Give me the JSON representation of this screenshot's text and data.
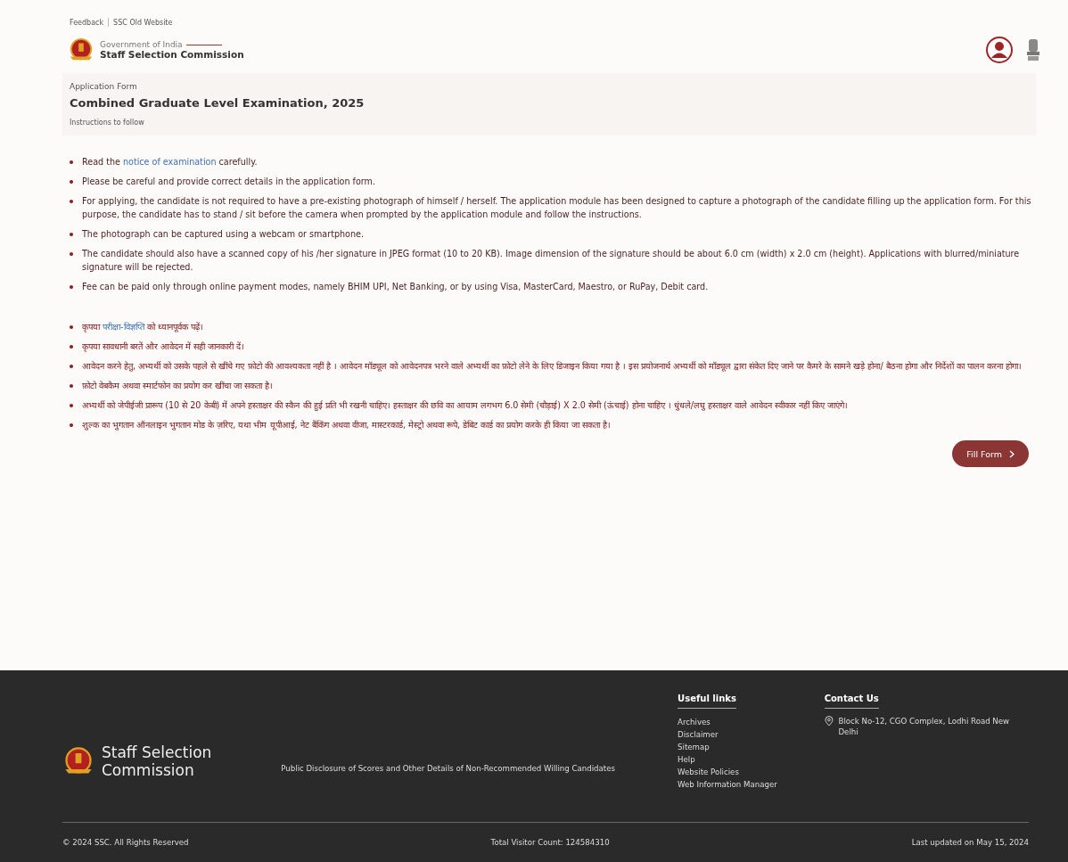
{
  "top_links": [
    "Feedback",
    "SSC Old Website"
  ],
  "header": {
    "subtitle": "Government of India",
    "title": "Staff Selection Commission"
  },
  "form_header": {
    "label": "Application Form",
    "title": "Combined Graduate Level Examination, 2025",
    "note": "Instructions to follow"
  },
  "instructions_en": [
    {
      "parts": [
        {
          "kind": "text",
          "text": "Read the "
        },
        {
          "kind": "link",
          "text": "notice of examination"
        },
        {
          "kind": "text",
          "text": " carefully."
        }
      ]
    },
    {
      "parts": [
        {
          "kind": "text",
          "text": "Please be careful and provide correct details in the application form."
        }
      ]
    },
    {
      "parts": [
        {
          "kind": "text",
          "text": "For applying, the candidate is not required to have a pre-existing photograph of himself / herself. The application module has been designed to capture a photograph of the candidate filling up the application form. For this purpose, the candidate has to stand / sit before the camera when prompted by the application module and follow the instructions."
        }
      ]
    },
    {
      "parts": [
        {
          "kind": "text",
          "text": "The photograph can be captured using a webcam or smartphone."
        }
      ]
    },
    {
      "parts": [
        {
          "kind": "text",
          "text": "The candidate should also have a scanned copy of his /her signature in JPEG format (10 to 20 KB). Image dimension of the signature should be about 6.0 cm (width) x 2.0 cm (height). Applications with blurred/miniature signature will be rejected."
        }
      ]
    },
    {
      "parts": [
        {
          "kind": "text",
          "text": "Fee can be paid only through online payment modes, namely BHIM UPI, Net Banking, or by using Visa, MasterCard, Maestro, or RuPay, Debit card."
        }
      ]
    }
  ],
  "instructions_hi": [
    {
      "parts": [
        {
          "kind": "text",
          "text": "कृपया "
        },
        {
          "kind": "link",
          "text": "परीक्षा-विज्ञप्ति"
        },
        {
          "kind": "text",
          "text": " को ध्यानपूर्वक पढ़ें।"
        }
      ]
    },
    {
      "parts": [
        {
          "kind": "text",
          "text": "कृपया सावधानी बरतें और आवेदन में सही जानकारी दें।"
        }
      ]
    },
    {
      "parts": [
        {
          "kind": "text",
          "text": "आवेदन करने हेतु, अभ्यर्थी को उसके पहले से खींचे गए फ़ोटो की आवश्यकता नहीं है । आवेदन मॉड्यूल को आवेदनपत्र भरने वाले अभ्यर्थी का फ़ोटो लेने के लिए डिजाइन किया गया है । इस प्रयोजनार्थ अभ्यर्थी को मॉड्यूल द्वारा संकेत दिए जाने पर कैमरे के सामने खड़े होना/ बैठना होगा और निर्देशों का पालन करना होगा।"
        }
      ]
    },
    {
      "parts": [
        {
          "kind": "text",
          "text": "फ़ोटो वेबकैम अथवा स्मार्टफोन का प्रयोग कर खींचा जा सकता है।"
        }
      ]
    },
    {
      "parts": [
        {
          "kind": "text",
          "text": "अभ्यर्थी को जेपीईजी प्रारूप (10 से 20 केबी) में अपने हस्ताक्षर की स्कैन की हुई प्रति भी रखनी चाहिए। हस्ताक्षर की छवि का आयाम लगभग 6.0 सेमी (चौड़ाई) X 2.0 सेमी (ऊंचाई) होना चाहिए । धुंधले/लघु हस्ताक्षर वाले आवेदन स्वीकार नहीं किए जाएंगे।"
        }
      ]
    },
    {
      "parts": [
        {
          "kind": "text",
          "text": "शुल्क का भुगतान ऑनलाइन भुगतान मोड के ज़रिए, यथा भीम यूपीआई, नेट बैंकिंग अथवा वीजा, मास्टरकार्ड, मेस्ट्रो अथवा रूपे, डेबिट कार्ड का प्रयोग करके ही किया जा सकता है।"
        }
      ]
    }
  ],
  "fill_button": "Fill Form",
  "footer": {
    "brand": "Staff Selection Commission",
    "disclosure": "Public Disclosure of Scores and Other Details of Non-Recommended Willing Candidates",
    "useful_links": {
      "title": "Useful links",
      "items": [
        "Archives",
        "Disclaimer",
        "Sitemap",
        "Help",
        "Website Policies",
        "Web Information Manager"
      ]
    },
    "contact": {
      "title": "Contact Us",
      "address": "Block No-12, CGO Complex, Lodhi Road New Delhi"
    },
    "copyright": "© 2024 SSC. All Rights Reserved",
    "visitors": "Total Visitor Count: 124584310",
    "updated": "Last updated on May 15, 2024"
  }
}
